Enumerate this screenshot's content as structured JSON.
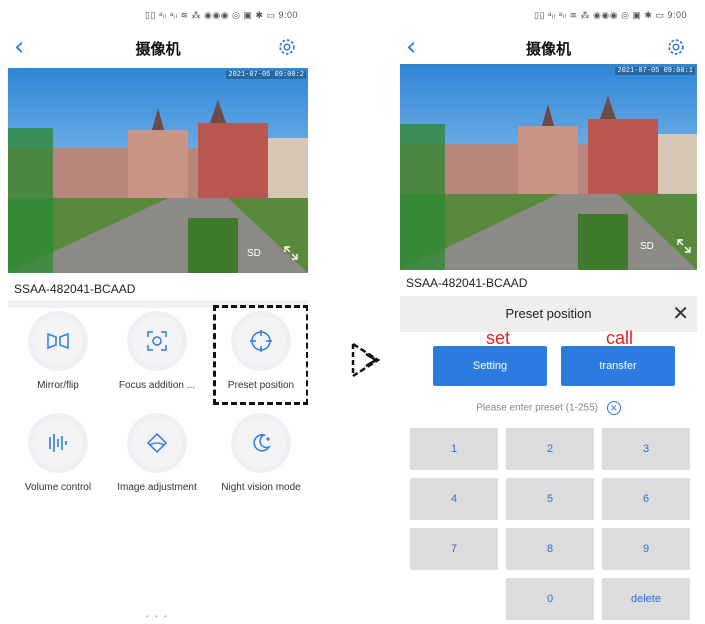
{
  "left": {
    "status": "▯▯ ᵃᵢₗ ᵃᵢₗ ≋ ⁂ ◉◉◉   ◎ ▣ ✱ ▭ 9:00",
    "title": "摄像机",
    "timestamp": "2021-07-05 09:00:2",
    "sd": "SD",
    "device": "SSAA-482041-BCAAD",
    "controls": [
      {
        "label": "Mirror/flip",
        "icon": "mirror-flip-icon"
      },
      {
        "label": "Focus addition ...",
        "icon": "focus-icon"
      },
      {
        "label": "Preset position",
        "icon": "preset-position-icon"
      },
      {
        "label": "Volume control",
        "icon": "volume-control-icon"
      },
      {
        "label": "Image adjustment",
        "icon": "image-adjustment-icon"
      },
      {
        "label": "Night vision mode",
        "icon": "night-vision-icon"
      }
    ],
    "page_dots": "• • •"
  },
  "right": {
    "status": "▯▯ ᵃᵢₗ ᵃᵢₗ ≋ ⁂ ◉◉◉   ◎ ▣ ✱ ▭ 9:00",
    "title": "摄像机",
    "timestamp": "2021-07-05 09:00:1",
    "sd": "SD",
    "device": "SSAA-482041-BCAAD",
    "panel_title": "Preset position",
    "setting_label": "Setting",
    "transfer_label": "transfer",
    "annotation_set": "set",
    "annotation_call": "call",
    "hint": "Please enter preset (1-255)",
    "keys": [
      "1",
      "2",
      "3",
      "4",
      "5",
      "6",
      "7",
      "8",
      "9",
      "0",
      "delete"
    ]
  },
  "colors": {
    "accent": "#2b7be0",
    "annotation": "#ee1a1a",
    "key_bg": "#dcdcdc"
  }
}
